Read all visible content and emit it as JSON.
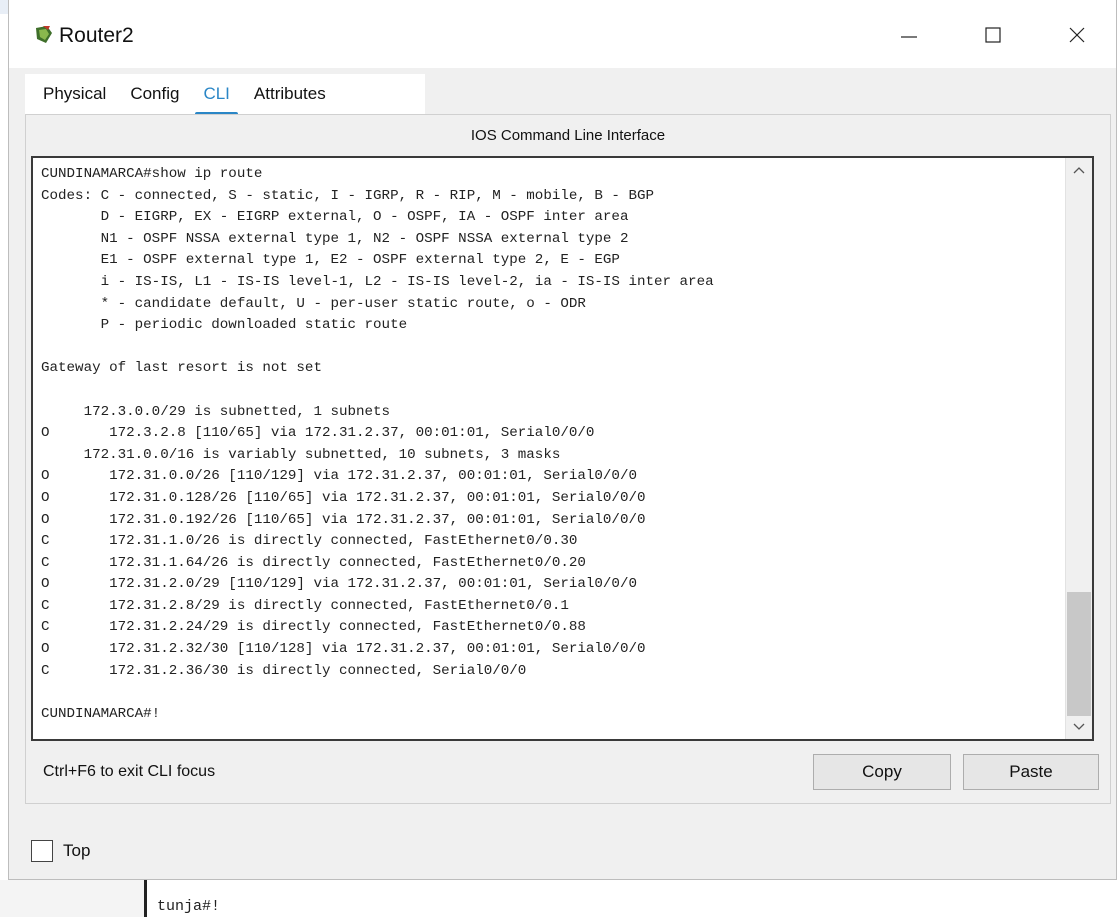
{
  "window": {
    "title": "Router2",
    "icon": "router-icon",
    "controls": {
      "minimize": "minimize-icon",
      "maximize": "maximize-icon",
      "close": "close-icon"
    }
  },
  "tabs": [
    {
      "label": "Physical",
      "active": false
    },
    {
      "label": "Config",
      "active": false
    },
    {
      "label": "CLI",
      "active": true
    },
    {
      "label": "Attributes",
      "active": false
    }
  ],
  "cli": {
    "header": "IOS Command Line Interface",
    "output": "CUNDINAMARCA#show ip route\nCodes: C - connected, S - static, I - IGRP, R - RIP, M - mobile, B - BGP\n       D - EIGRP, EX - EIGRP external, O - OSPF, IA - OSPF inter area\n       N1 - OSPF NSSA external type 1, N2 - OSPF NSSA external type 2\n       E1 - OSPF external type 1, E2 - OSPF external type 2, E - EGP\n       i - IS-IS, L1 - IS-IS level-1, L2 - IS-IS level-2, ia - IS-IS inter area\n       * - candidate default, U - per-user static route, o - ODR\n       P - periodic downloaded static route\n\nGateway of last resort is not set\n\n     172.3.0.0/29 is subnetted, 1 subnets\nO       172.3.2.8 [110/65] via 172.31.2.37, 00:01:01, Serial0/0/0\n     172.31.0.0/16 is variably subnetted, 10 subnets, 3 masks\nO       172.31.0.0/26 [110/129] via 172.31.2.37, 00:01:01, Serial0/0/0\nO       172.31.0.128/26 [110/65] via 172.31.2.37, 00:01:01, Serial0/0/0\nO       172.31.0.192/26 [110/65] via 172.31.2.37, 00:01:01, Serial0/0/0\nC       172.31.1.0/26 is directly connected, FastEthernet0/0.30\nC       172.31.1.64/26 is directly connected, FastEthernet0/0.20\nO       172.31.2.0/29 [110/129] via 172.31.2.37, 00:01:01, Serial0/0/0\nC       172.31.2.8/29 is directly connected, FastEthernet0/0.1\nC       172.31.2.24/29 is directly connected, FastEthernet0/0.88\nO       172.31.2.32/30 [110/128] via 172.31.2.37, 00:01:01, Serial0/0/0\nC       172.31.2.36/30 is directly connected, Serial0/0/0\n\nCUNDINAMARCA#!",
    "hint": "Ctrl+F6 to exit CLI focus",
    "copy_label": "Copy",
    "paste_label": "Paste"
  },
  "top_checkbox": {
    "label": "Top",
    "checked": false
  },
  "background_window": {
    "text": "tunja#!"
  }
}
